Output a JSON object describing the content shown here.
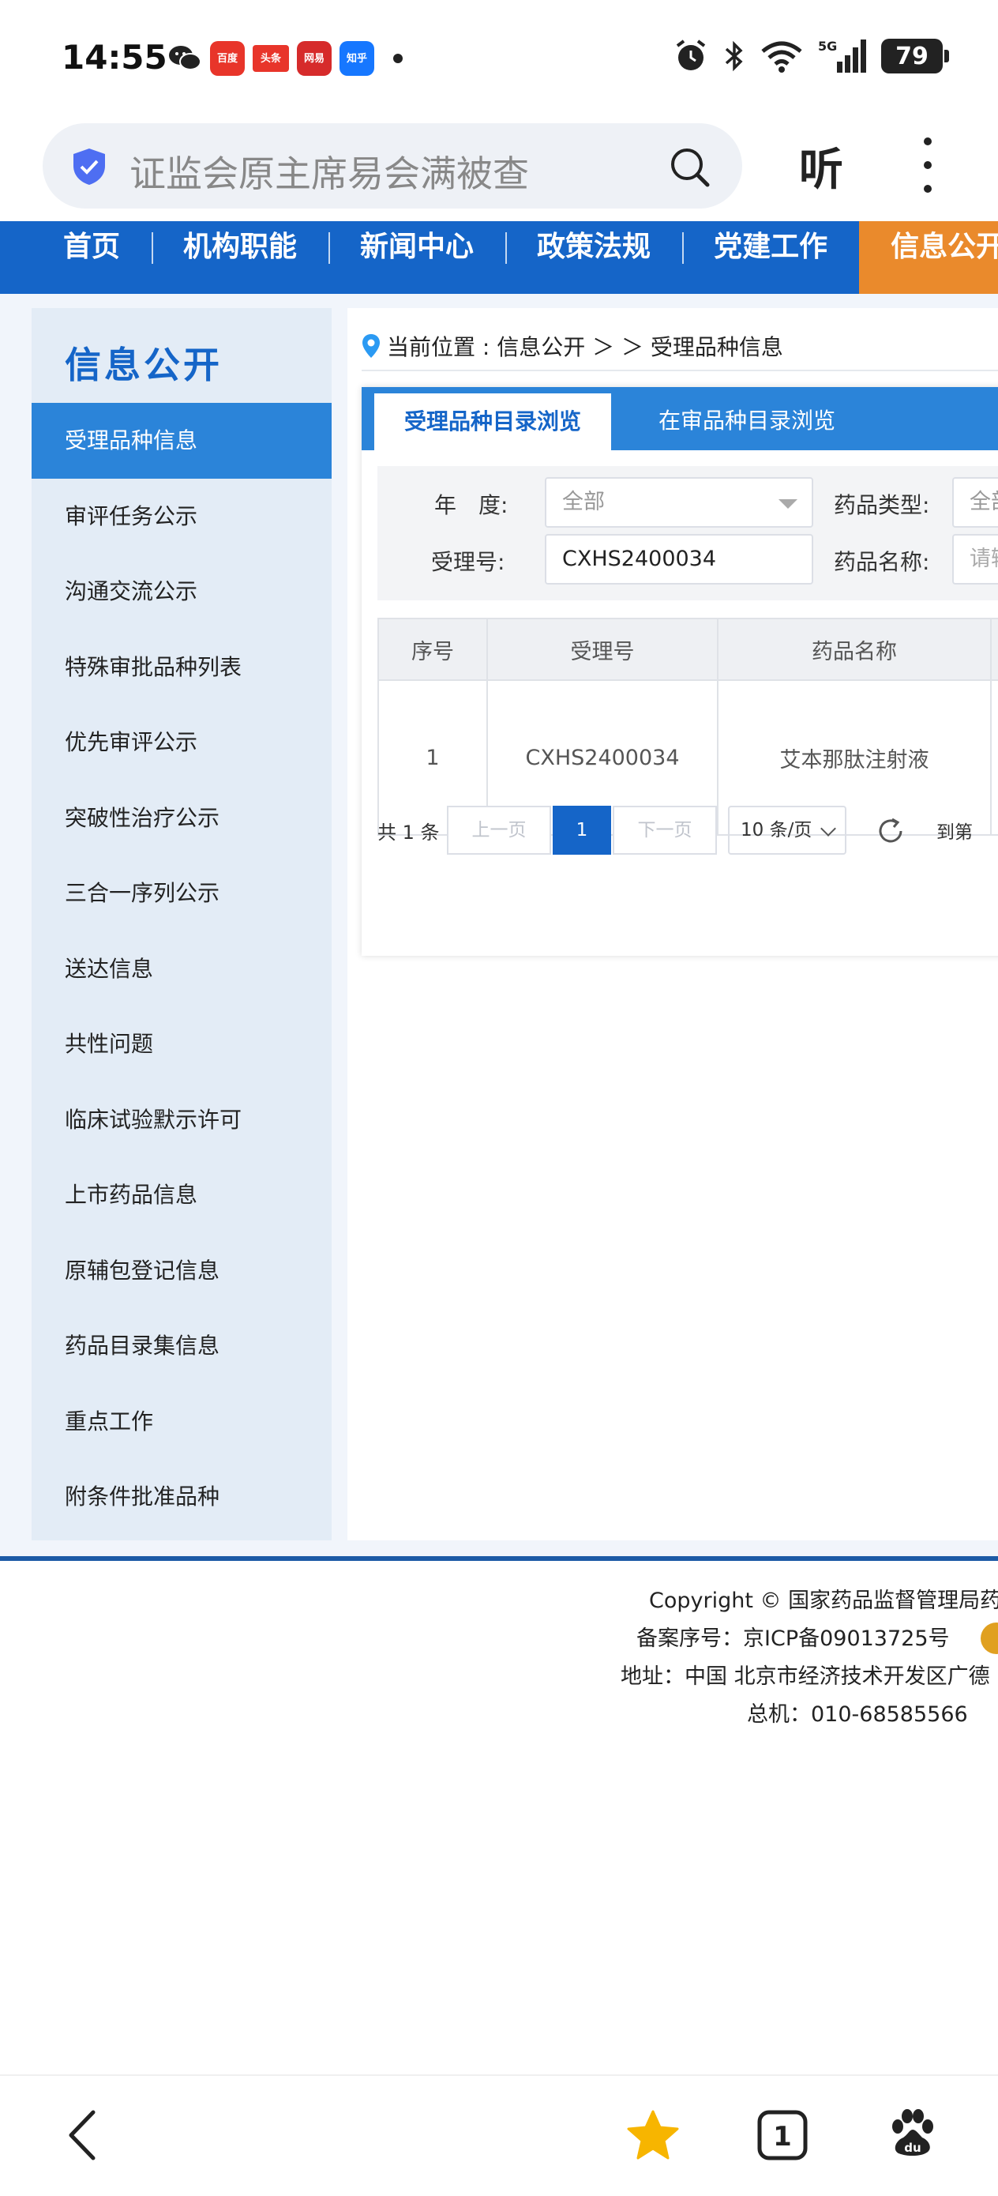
{
  "status_bar": {
    "time": "14:55",
    "notification_apps": [
      {
        "name": "wechat-icon",
        "label": "",
        "color": "#222222"
      },
      {
        "name": "toutiao-search-icon",
        "label": "百度",
        "color": "#e8352a"
      },
      {
        "name": "toutiao-icon",
        "label": "头条",
        "color": "#e8352a"
      },
      {
        "name": "netease-icon",
        "label": "网易",
        "color": "#d62b2b"
      },
      {
        "name": "zhihu-icon",
        "label": "知乎",
        "color": "#1677ff"
      }
    ],
    "network": "5G",
    "battery": "79"
  },
  "browser": {
    "address_text": "证监会原主席易会满被查",
    "listen_label": "听"
  },
  "site_nav": {
    "items": [
      "首页",
      "机构职能",
      "新闻中心",
      "政策法规",
      "党建工作",
      "信息公开"
    ],
    "active_index": 5,
    "colors": {
      "nav_bg": "#1565c8",
      "active_bg": "#ea8a2c"
    }
  },
  "sidebar": {
    "title": "信息公开",
    "items": [
      "受理品种信息",
      "审评任务公示",
      "沟通交流公示",
      "特殊审批品种列表",
      "优先审评公示",
      "突破性治疗公示",
      "三合一序列公示",
      "送达信息",
      "共性问题",
      "临床试验默示许可",
      "上市药品信息",
      "原辅包登记信息",
      "药品目录集信息",
      "重点工作",
      "附条件批准品种"
    ],
    "active_index": 0
  },
  "breadcrumb": {
    "text": "当前位置 : 信息公开 ＞ ＞ 受理品种信息"
  },
  "tabs": [
    "受理品种目录浏览",
    "在审品种目录浏览"
  ],
  "filters": {
    "year_label": "年　度:",
    "year_value": "全部",
    "drug_type_label": "药品类型:",
    "drug_type_value": "全部",
    "accept_no_label": "受理号:",
    "accept_no_value": "CXHS2400034",
    "drug_name_label": "药品名称:",
    "drug_name_placeholder": "请输"
  },
  "table": {
    "headers": [
      "序号",
      "受理号",
      "药品名称"
    ],
    "rows": [
      [
        "1",
        "CXHS2400034",
        "艾本那肽注射液"
      ]
    ]
  },
  "pagination": {
    "total": "共 1 条",
    "prev": "上一页",
    "current_page": "1",
    "next": "下一页",
    "page_size": "10 条/页",
    "goto_label": "到第"
  },
  "footer": {
    "copyright": "Copyright © 国家药品监督管理局药品",
    "icp": "备案序号：京ICP备09013725号",
    "address": "地址：中国 北京市经济技术开发区广德",
    "phone": "总机：010-68585566"
  }
}
